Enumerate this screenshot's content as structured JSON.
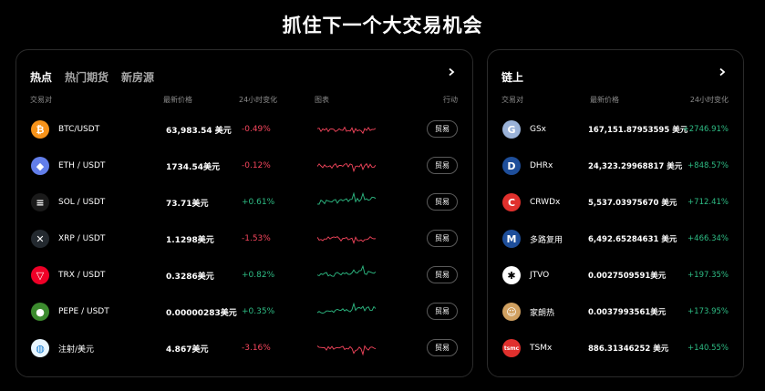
{
  "page_title": "抓住下一个大交易机会",
  "left_panel": {
    "tabs": [
      {
        "label": "热点",
        "active": true
      },
      {
        "label": "热门期货",
        "active": false
      },
      {
        "label": "新房源",
        "active": false
      }
    ],
    "headers": {
      "pair": "交易对",
      "price": "最新价格",
      "change": "24小时变化",
      "chart": "图表",
      "action": "行动"
    },
    "trade_label": "贸易",
    "rows": [
      {
        "pair": "BTC/USDT",
        "price": "63,983.54 美元",
        "change": "-0.49%",
        "icon": "bitcoin-icon",
        "color": "#f7931a",
        "glyph": "₿",
        "trend": "neg"
      },
      {
        "pair": "ETH / USDT",
        "price": "1734.54美元",
        "change": "-0.12%",
        "icon": "ethereum-icon",
        "color": "#627eea",
        "glyph": "◆",
        "trend": "neg"
      },
      {
        "pair": "SOL / USDT",
        "price": "73.71美元",
        "change": "+0.61%",
        "icon": "solana-icon",
        "color": "#1a1a1a",
        "glyph": "≡",
        "trend": "pos"
      },
      {
        "pair": "XRP / USDT",
        "price": "1.1298美元",
        "change": "-1.53%",
        "icon": "xrp-icon",
        "color": "#23292f",
        "glyph": "✕",
        "trend": "neg"
      },
      {
        "pair": "TRX / USDT",
        "price": "0.3286美元",
        "change": "+0.82%",
        "icon": "tron-icon",
        "color": "#ef0027",
        "glyph": "▽",
        "trend": "pos"
      },
      {
        "pair": "PEPE / USDT",
        "price": "0.00000283美元",
        "change": "+0.35%",
        "icon": "pepe-icon",
        "color": "#3c8b2e",
        "glyph": "●",
        "trend": "pos"
      },
      {
        "pair": "注射/美元",
        "price": "4.867美元",
        "change": "-3.16%",
        "icon": "injective-icon",
        "color": "#e8f6ff",
        "glyph": "◍",
        "trend": "neg"
      }
    ]
  },
  "right_panel": {
    "title": "链上",
    "headers": {
      "pair": "交易对",
      "price": "最新价格",
      "change": "24小时变化"
    },
    "rows": [
      {
        "pair": "GSx",
        "price": "167,151.87953595 美元",
        "change": "+2746.91%",
        "icon": "gsx-icon",
        "color": "#9ab2d8",
        "glyph": "G"
      },
      {
        "pair": "DHRx",
        "price": "24,323.29968817 美元",
        "change": "+848.57%",
        "icon": "dhrx-icon",
        "color": "#1e4e9a",
        "glyph": "D"
      },
      {
        "pair": "CRWDx",
        "price": "5,537.03975670 美元",
        "change": "+712.41%",
        "icon": "crwdx-icon",
        "color": "#e0302d",
        "glyph": "C"
      },
      {
        "pair": "多路复用",
        "price": "6,492.65284631 美元",
        "change": "+466.34%",
        "icon": "multiplex-icon",
        "color": "#1e4e9a",
        "glyph": "M"
      },
      {
        "pair": "JTVO",
        "price": "0.0027509591美元",
        "change": "+197.35%",
        "icon": "jtvo-icon",
        "color": "#ffffff",
        "glyph": "✱"
      },
      {
        "pair": "家朗热",
        "price": "0.0037993561美元",
        "change": "+173.95%",
        "icon": "jialangre-icon",
        "color": "#d0a060",
        "glyph": "☺"
      },
      {
        "pair": "TSMx",
        "price": "886.31346252 美元",
        "change": "+140.55%",
        "icon": "tsmx-icon",
        "color": "#e0302d",
        "glyph": "tsmc"
      }
    ]
  }
}
